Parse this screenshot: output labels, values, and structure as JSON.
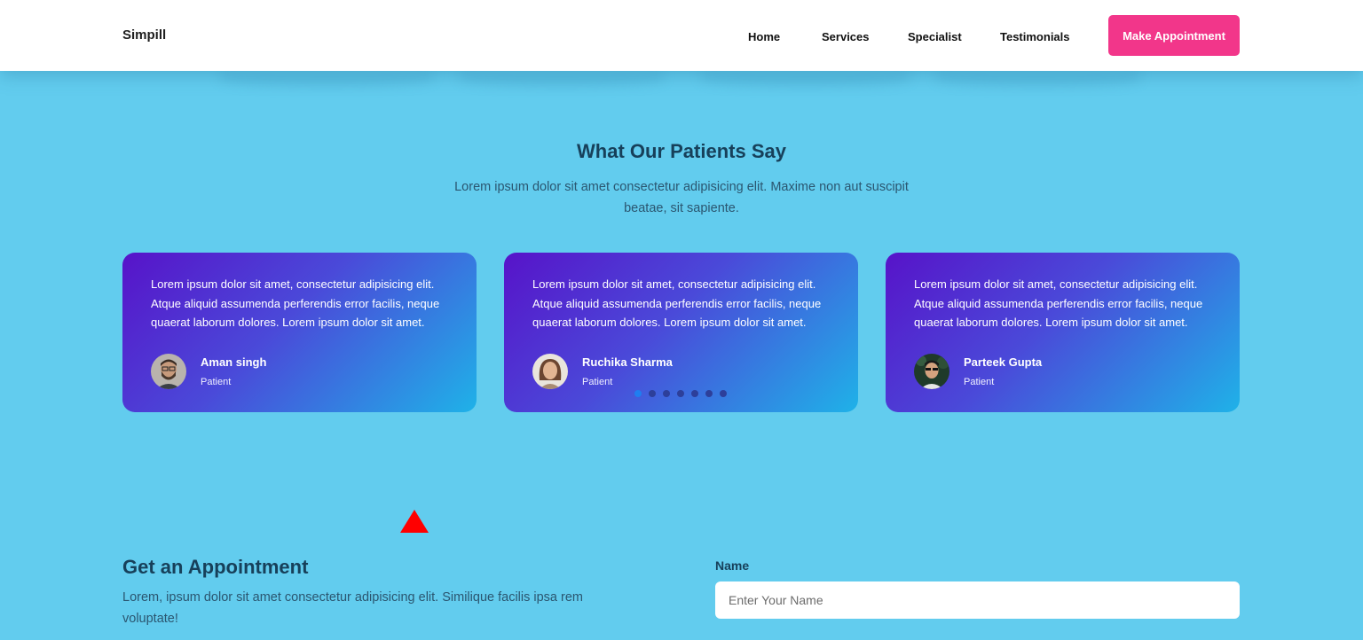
{
  "header": {
    "brand": "Simpill",
    "nav": [
      {
        "label": "Home"
      },
      {
        "label": "Services"
      },
      {
        "label": "Specialist"
      },
      {
        "label": "Testimonials"
      }
    ],
    "cta_label": "Make Appointment"
  },
  "testimonials": {
    "title": "What Our Patients Say",
    "subtitle": "Lorem ipsum dolor sit amet consectetur adipisicing elit. Maxime non aut suscipit beatae, sit sapiente.",
    "cards": [
      {
        "text": "Lorem ipsum dolor sit amet, consectetur adipisicing elit. Atque aliquid assumenda perferendis error facilis, neque quaerat laborum dolores. Lorem ipsum dolor sit amet.",
        "name": "Aman singh",
        "role": "Patient"
      },
      {
        "text": "Lorem ipsum dolor sit amet, consectetur adipisicing elit. Atque aliquid assumenda perferendis error facilis, neque quaerat laborum dolores. Lorem ipsum dolor sit amet.",
        "name": "Ruchika Sharma",
        "role": "Patient"
      },
      {
        "text": "Lorem ipsum dolor sit amet, consectetur adipisicing elit. Atque aliquid assumenda perferendis error facilis, neque quaerat laborum dolores. Lorem ipsum dolor sit amet.",
        "name": "Parteek Gupta",
        "role": "Patient"
      }
    ],
    "carousel": {
      "pages": 7,
      "active": 1
    }
  },
  "appointment": {
    "title": "Get an Appointment",
    "subtitle": "Lorem, ipsum dolor sit amet consectetur adipisicing elit. Similique facilis ipsa rem voluptate!",
    "name_label": "Name",
    "name_placeholder": "Enter Your Name",
    "name_value": ""
  },
  "colors": {
    "page_bg": "#62ccee",
    "cta": "#f2368a",
    "card_gradient_start": "#5713c9",
    "card_gradient_end": "#1fb2e8",
    "heading": "#17405a",
    "marker": "#ff0000"
  }
}
